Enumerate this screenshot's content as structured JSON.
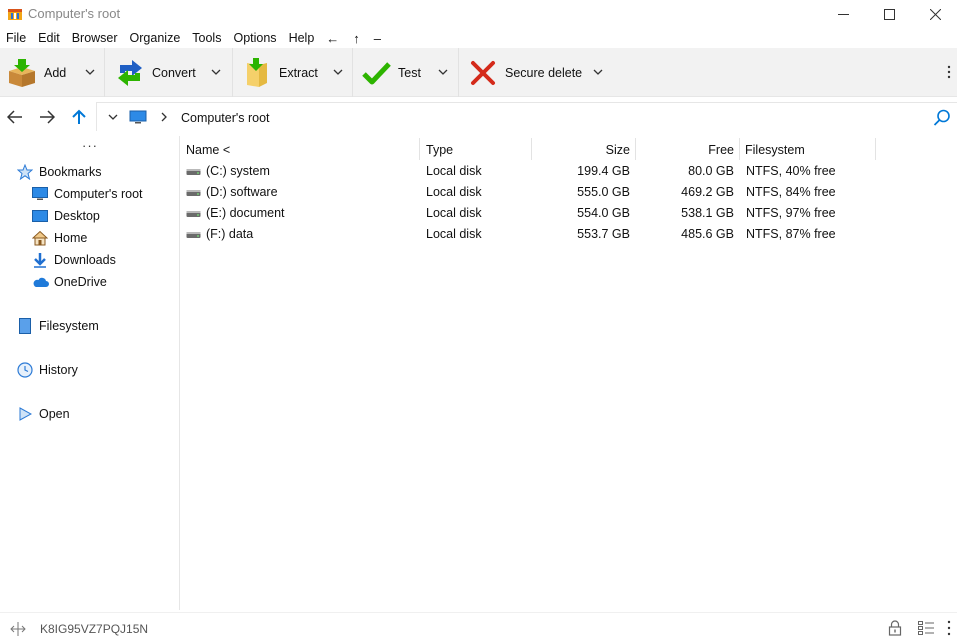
{
  "window": {
    "title": "Computer's root",
    "min_glyph": "—",
    "max_glyph": "☐",
    "close_glyph": "✕"
  },
  "menu": {
    "items": [
      "File",
      "Edit",
      "Browser",
      "Organize",
      "Tools",
      "Options",
      "Help"
    ],
    "back_glyph": "←",
    "up_glyph": "↑",
    "dash_glyph": "–"
  },
  "toolbar": {
    "add_label": "Add",
    "convert_label": "Convert",
    "extract_label": "Extract",
    "test_label": "Test",
    "secure_delete_label": "Secure delete"
  },
  "address": {
    "path": "Computer's root"
  },
  "sidebar": {
    "dots": "···",
    "items": [
      {
        "label": "Bookmarks",
        "icon": "star-icon"
      },
      {
        "label": "Computer's root",
        "icon": "monitor-icon"
      },
      {
        "label": "Desktop",
        "icon": "desktop-icon"
      },
      {
        "label": "Home",
        "icon": "home-icon"
      },
      {
        "label": "Downloads",
        "icon": "download-icon"
      },
      {
        "label": "OneDrive",
        "icon": "cloud-icon"
      },
      {
        "label": "Filesystem",
        "icon": "filesystem-icon"
      },
      {
        "label": "History",
        "icon": "clock-icon"
      },
      {
        "label": "Open",
        "icon": "play-icon"
      }
    ]
  },
  "filelist": {
    "columns": {
      "name": "Name <",
      "type": "Type",
      "size": "Size",
      "free": "Free",
      "filesystem": "Filesystem"
    },
    "rows": [
      {
        "name": "(C:) system",
        "type": "Local disk",
        "size": "199.4 GB",
        "free": "80.0 GB",
        "filesystem": "NTFS, 40% free"
      },
      {
        "name": "(D:) software",
        "type": "Local disk",
        "size": "555.0 GB",
        "free": "469.2 GB",
        "filesystem": "NTFS, 84% free"
      },
      {
        "name": "(E:) document",
        "type": "Local disk",
        "size": "554.0 GB",
        "free": "538.1 GB",
        "filesystem": "NTFS, 97% free"
      },
      {
        "name": "(F:) data",
        "type": "Local disk",
        "size": "553.7 GB",
        "free": "485.6 GB",
        "filesystem": "NTFS, 87% free"
      }
    ]
  },
  "status": {
    "text": "K8IG95VZ7PQJ15N"
  },
  "colors": {
    "accent": "#0078d7",
    "toolbar_bg": "#f2f2f2",
    "test_green": "#2db400",
    "delete_red": "#d42a1a"
  }
}
